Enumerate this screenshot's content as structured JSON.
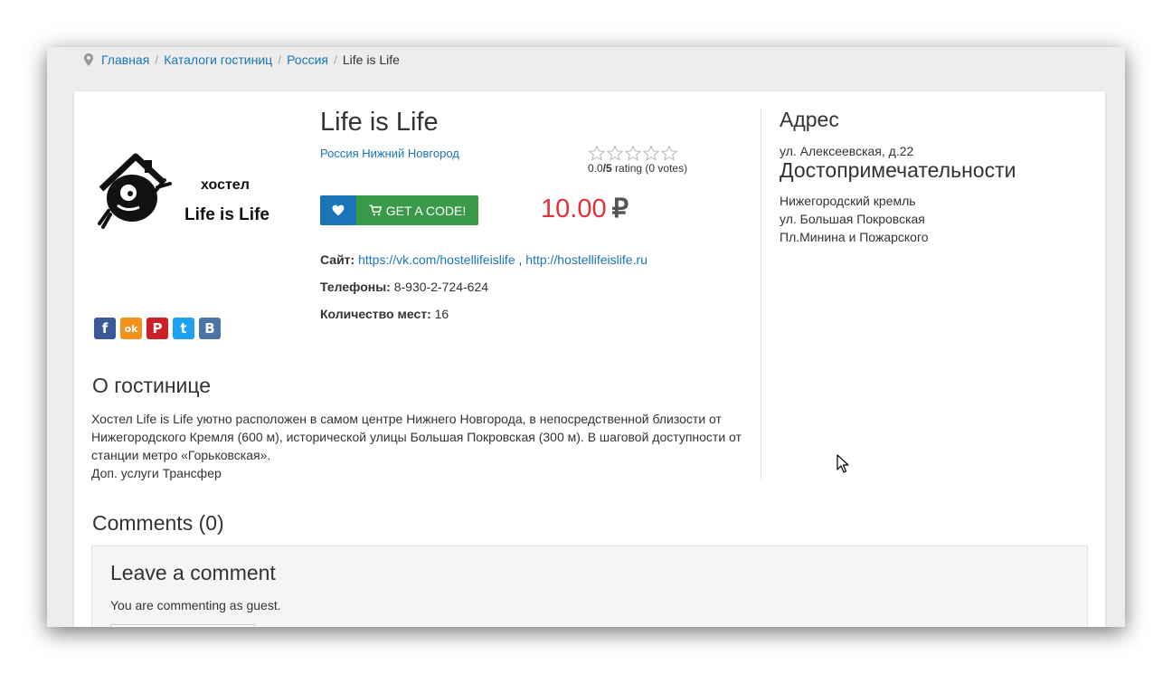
{
  "breadcrumb": {
    "items": [
      {
        "label": "Главная"
      },
      {
        "label": "Каталоги гостиниц"
      },
      {
        "label": "Россия"
      }
    ],
    "current": "Life is Life"
  },
  "hotel": {
    "logo_text_top": "хостел",
    "logo_text_bottom": "Life is Life",
    "title": "Life is Life",
    "location": "Россия Нижний Новгород",
    "rating": {
      "score": "0.0",
      "max": "/5",
      "label": "rating",
      "votes": "(0 votes)",
      "stars_filled": 0,
      "stars_total": 5
    },
    "buttons": {
      "code_label": "GET A CODE!"
    },
    "price": {
      "value": "10.00",
      "currency": "₽"
    },
    "site_label": "Сайт:",
    "site_links": [
      "https://vk.com/hostellifeislife",
      "http://hostellifeislife.ru"
    ],
    "site_sep": ",",
    "phones_label": "Телефоны:",
    "phones_value": "8-930-2-724-624",
    "places_label": "Количество мест:",
    "places_value": "16"
  },
  "share": [
    {
      "icon": "facebook-icon",
      "glyph": "f",
      "color": "#3b5998"
    },
    {
      "icon": "odnoklassniki-icon",
      "glyph": "ok",
      "color": "#f2911b"
    },
    {
      "icon": "pinterest-icon",
      "glyph": "P",
      "color": "#cb2027"
    },
    {
      "icon": "twitter-icon",
      "glyph": "t",
      "color": "#1da1f2"
    },
    {
      "icon": "vk-icon",
      "glyph": "B",
      "color": "#4c75a3"
    }
  ],
  "about": {
    "heading": "О гостинице",
    "text": "Хостел Life is Life уютно расположен в самом центре Нижнего Новгорода, в непосредственной близости от Нижегородского Кремля (600 м), исторической улицы Большая Покровская (300 м). В шаговой доступности от станции метро «Горьковская».",
    "extra": "Доп. услуги Трансфер"
  },
  "address": {
    "heading": "Адрес",
    "value": "ул. Алексеевская, д.22"
  },
  "sights": {
    "heading": "Достопримечательности",
    "items": [
      "Нижегородский кремль",
      "ул. Большая Покровская",
      "Пл.Минина и Пожарского"
    ]
  },
  "comments": {
    "heading": "Comments (0)",
    "box_heading": "Leave a comment",
    "guest_note": "You are commenting as guest."
  }
}
